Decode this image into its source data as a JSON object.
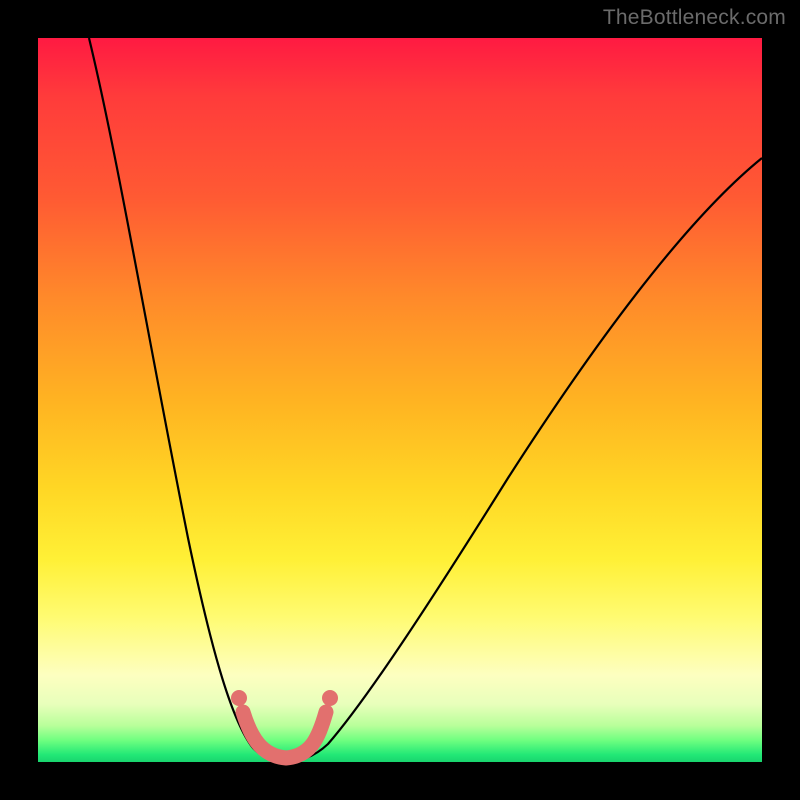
{
  "watermark": "TheBottleneck.com",
  "colors": {
    "frame": "#000000",
    "curve_stroke": "#000000",
    "highlight_stroke": "#e2706e",
    "highlight_dot": "#e2706e"
  },
  "chart_data": {
    "type": "line",
    "title": "",
    "xlabel": "",
    "ylabel": "",
    "xlim": [
      0,
      100
    ],
    "ylim": [
      0,
      100
    ],
    "grid": false,
    "legend": false,
    "note": "Bottleneck-style V-curve. x is an unlabeled component-ratio axis (0–100%). y is bottleneck severity in percent, where 0 is ideal (green band at the bottom) and 100 is worst (red at the top). The thin black curve is the full function; the thick salmon segment marks the near-zero-bottleneck region, with dots at its endpoints.",
    "series": [
      {
        "name": "bottleneck_curve",
        "x": [
          7,
          9,
          11,
          13,
          15,
          17,
          19,
          21,
          23,
          25,
          27,
          29,
          30,
          31,
          33,
          35,
          38,
          42,
          46,
          50,
          55,
          60,
          65,
          70,
          75,
          80,
          85,
          90,
          95,
          100
        ],
        "y": [
          100,
          90,
          80,
          70,
          60,
          50,
          41,
          33,
          25,
          18,
          12,
          7,
          4,
          2,
          0,
          0,
          2,
          6,
          11,
          17,
          24,
          31,
          38,
          44,
          50,
          55,
          60,
          64,
          68,
          71
        ]
      },
      {
        "name": "optimal_range_highlight",
        "x": [
          29,
          31,
          33,
          35,
          37,
          39
        ],
        "y": [
          7,
          1.5,
          0,
          0,
          1.5,
          7
        ]
      }
    ],
    "markers": [
      {
        "name": "optimal_range_start",
        "x": 29,
        "y": 7
      },
      {
        "name": "optimal_range_end",
        "x": 39,
        "y": 7
      }
    ],
    "background_gradient_stops": [
      {
        "pct": 0,
        "color": "#ff1a42"
      },
      {
        "pct": 50,
        "color": "#ffb322"
      },
      {
        "pct": 80,
        "color": "#fffb72"
      },
      {
        "pct": 100,
        "color": "#19d46e"
      }
    ]
  }
}
